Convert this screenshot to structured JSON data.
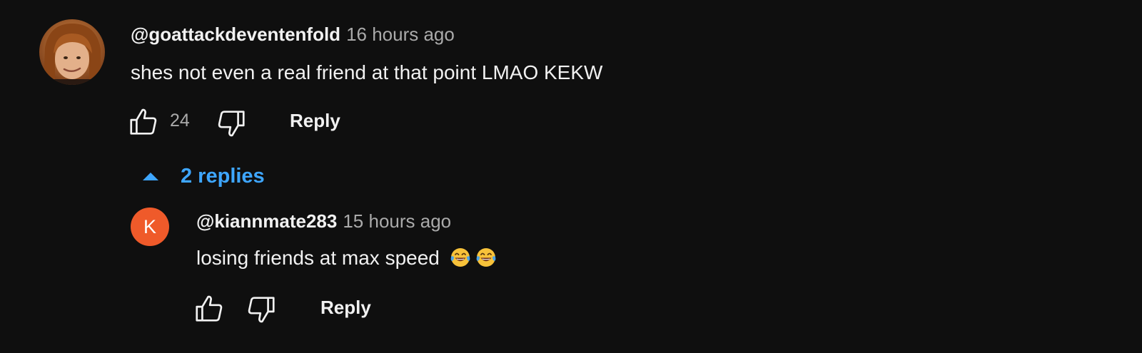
{
  "comment": {
    "author": "@goattackdeventenfold",
    "time": "16 hours ago",
    "text": "shes not even a real friend at that point LMAO KEKW",
    "like_count": "24",
    "reply_label": "Reply",
    "avatar_icon": "user-photo"
  },
  "replies_toggle": {
    "label": "2 replies",
    "icon": "caret-up-icon",
    "color": "#3ea6ff"
  },
  "reply": {
    "avatar_letter": "K",
    "avatar_color": "#ef5a2a",
    "author": "@kiannmate283",
    "time": "15 hours ago",
    "text": "losing friends at max speed",
    "emoji": [
      "face-with-tears-of-joy",
      "face-with-tears-of-joy"
    ],
    "reply_label": "Reply"
  },
  "colors": {
    "background": "#0f0f0f",
    "text": "#f1f1f1",
    "secondary": "#aaaaaa",
    "link": "#3ea6ff"
  }
}
